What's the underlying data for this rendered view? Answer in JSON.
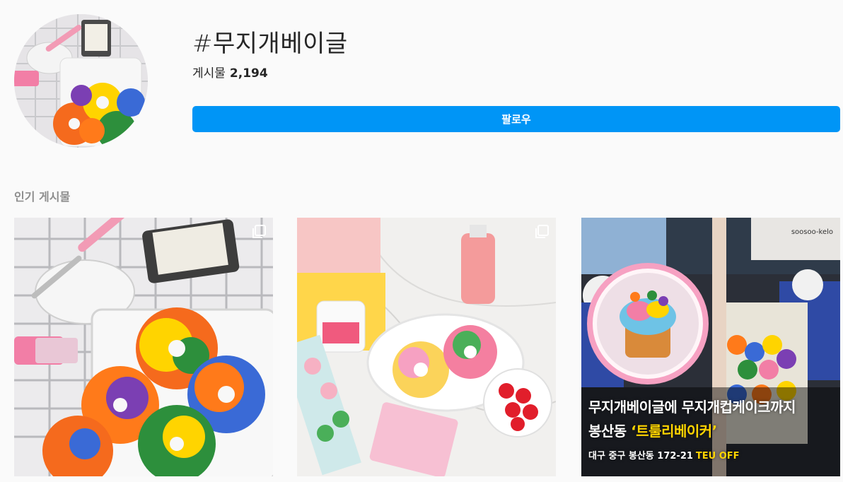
{
  "header": {
    "hashtag": "#무지개베이글",
    "posts_label": "게시물",
    "posts_count": "2,194",
    "follow_label": "팔로우"
  },
  "section": {
    "title": "인기 게시물"
  },
  "posts": [
    {
      "type": "carousel"
    },
    {
      "type": "carousel"
    },
    {
      "type": "single",
      "overlay_line1": "무지개베이글에 무지개컵케이크까지",
      "overlay_line2_prefix": "봉산동 ",
      "overlay_line2_highlight": "‘트룰리베이커’",
      "overlay_line3": "대구 중구 봉산동 172-21",
      "overlay_brand": "TEU OFF",
      "shop_sign": "soosoo-kelo"
    }
  ],
  "colors": {
    "follow_button": "#0095f6",
    "background": "#fafafa",
    "muted_text": "#8e8e8e"
  },
  "icons": {
    "carousel": "multiple-posts-icon"
  }
}
